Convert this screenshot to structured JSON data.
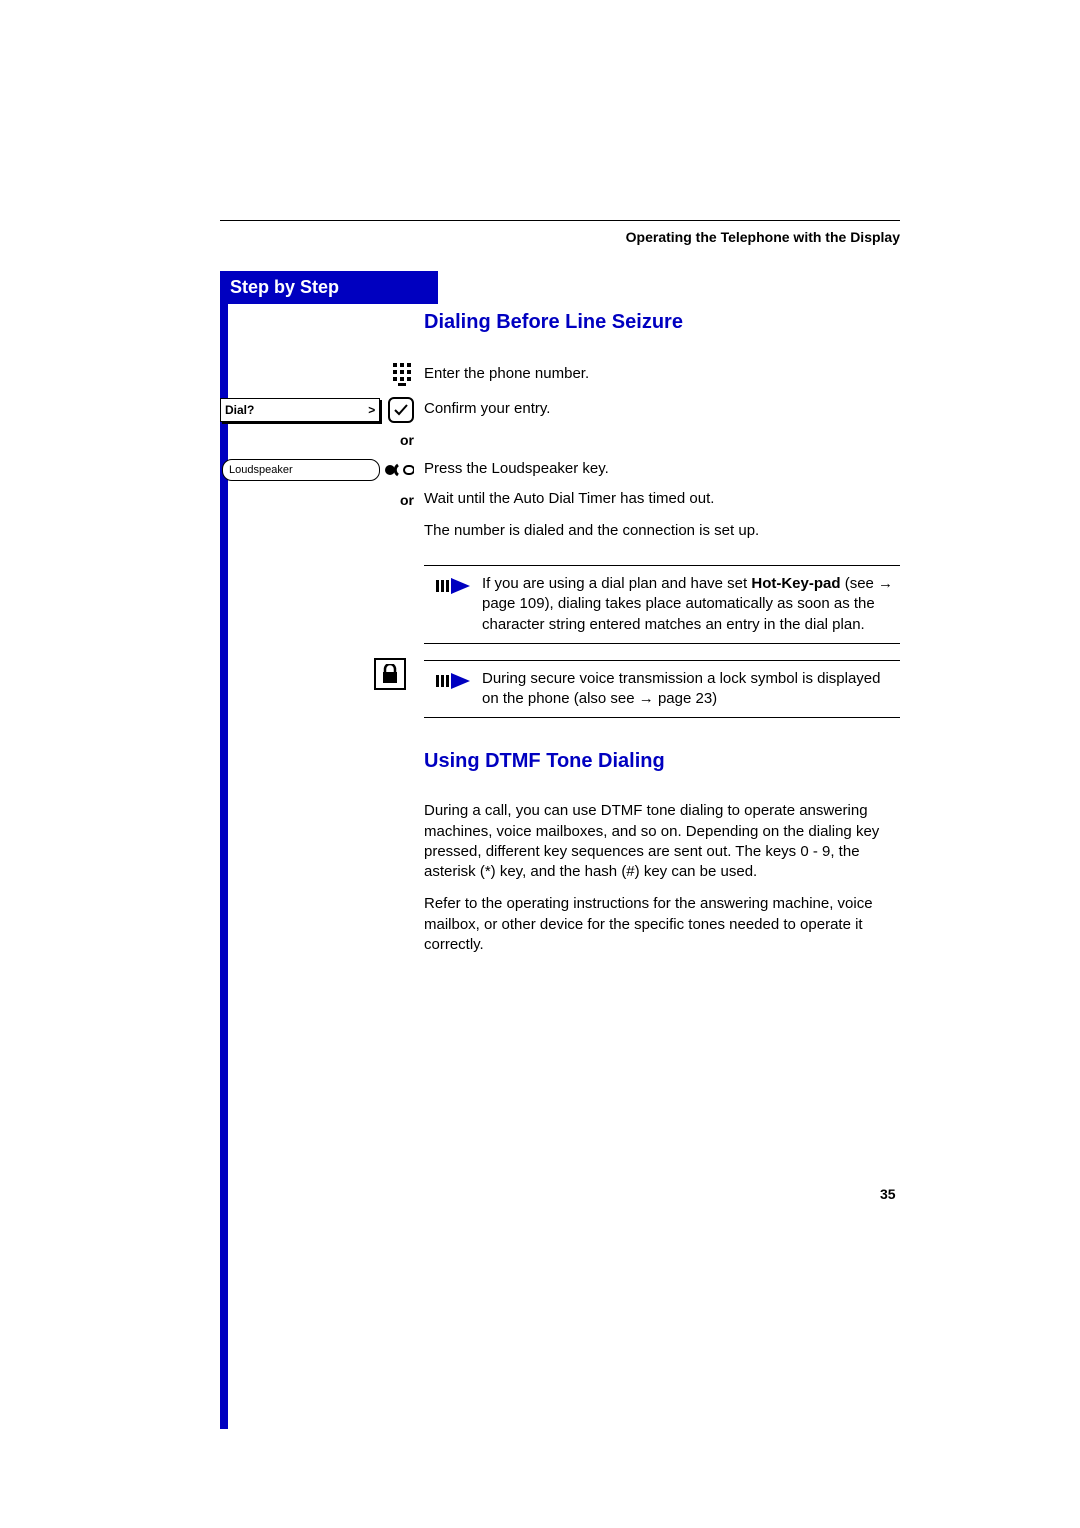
{
  "header": {
    "title": "Operating the Telephone with the Display"
  },
  "sidebar": {
    "title": "Step by Step"
  },
  "sections": {
    "s1": {
      "heading": "Dialing Before Line Seizure",
      "step1": "Enter the phone number.",
      "dialq": "Dial?",
      "step2": "Confirm your entry.",
      "or1": "or",
      "loud": "Loudspeaker",
      "step3": "Press the Loudspeaker key.",
      "or2": "or",
      "step4": "Wait until the Auto Dial Timer has timed out.",
      "step5": "The number is dialed and the connection is set up.",
      "note1_pre": "If you are using a dial plan and have set ",
      "note1_bold": "Hot-Key-pad",
      "note1_mid": " (see ",
      "note1_arrow": "→",
      "note1_pg": " page 109), dialing takes place automatically as soon as the character string entered matches an entry in the dial plan.",
      "note2_a": "During secure voice transmission a lock symbol is displayed on the phone (also see ",
      "note2_arrow": "→",
      "note2_b": " page 23)"
    },
    "s2": {
      "heading": "Using DTMF Tone Dialing",
      "p1": "During a call, you can use DTMF tone dialing to operate answering machines, voice mailboxes, and so on. Depending on the dialing key pressed, different key sequences are sent out. The keys 0 - 9, the asterisk (*) key, and the hash (#) key can be used.",
      "p2": "Refer to the operating instructions for the answering machine, voice mailbox, or other device for the specific tones needed to operate it correctly."
    }
  },
  "page_number": "35"
}
